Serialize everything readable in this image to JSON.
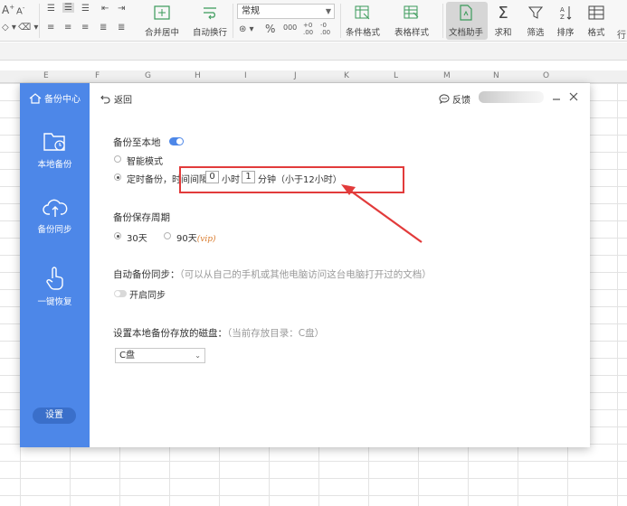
{
  "ribbon": {
    "font_size_up": "A",
    "font_size_down": "A",
    "merge_center": "合并居中",
    "wrap_text": "自动换行",
    "number_format": "常规",
    "currency_symbol": "%",
    "thousands": "000",
    "dec_increase": "+0 .00",
    "dec_decrease": "-0 .00",
    "conditional_format": "条件格式",
    "table_style": "表格样式",
    "doc_assistant": "文档助手",
    "sum": "求和",
    "filter": "筛选",
    "sort": "排序",
    "format": "格式",
    "more": "行"
  },
  "column_headers": [
    "E",
    "F",
    "G",
    "H",
    "I",
    "J",
    "K",
    "L",
    "M",
    "N",
    "O"
  ],
  "dialog": {
    "brand": "备份中心",
    "nav": [
      {
        "label": "本地备份"
      },
      {
        "label": "备份同步"
      },
      {
        "label": "一键恢复"
      }
    ],
    "settings_label": "设置",
    "back_label": "返回",
    "feedback_label": "反馈",
    "backup_local": {
      "title": "备份至本地",
      "smart_mode": "智能模式",
      "timed_prefix": "定时备份，时间间隔",
      "hours_value": "0",
      "hours_unit": "小时",
      "minutes_value": "1",
      "minutes_unit": "分钟",
      "timed_note": "（小于12小时）"
    },
    "retention": {
      "title": "备份保存周期",
      "option_30": "30天",
      "option_90": "90天",
      "vip": "(vip)"
    },
    "auto_sync": {
      "title": "自动备份同步：",
      "hint": "（可以从自己的手机或其他电脑访问这台电脑打开过的文档）",
      "toggle_label": "开启同步"
    },
    "disk": {
      "title": "设置本地备份存放的磁盘：",
      "hint": "（当前存放目录：C盘）",
      "selected": "C盘"
    }
  },
  "colors": {
    "sidebar": "#4d87e8",
    "highlight": "#e23b3b",
    "vip": "#d97a2b"
  }
}
